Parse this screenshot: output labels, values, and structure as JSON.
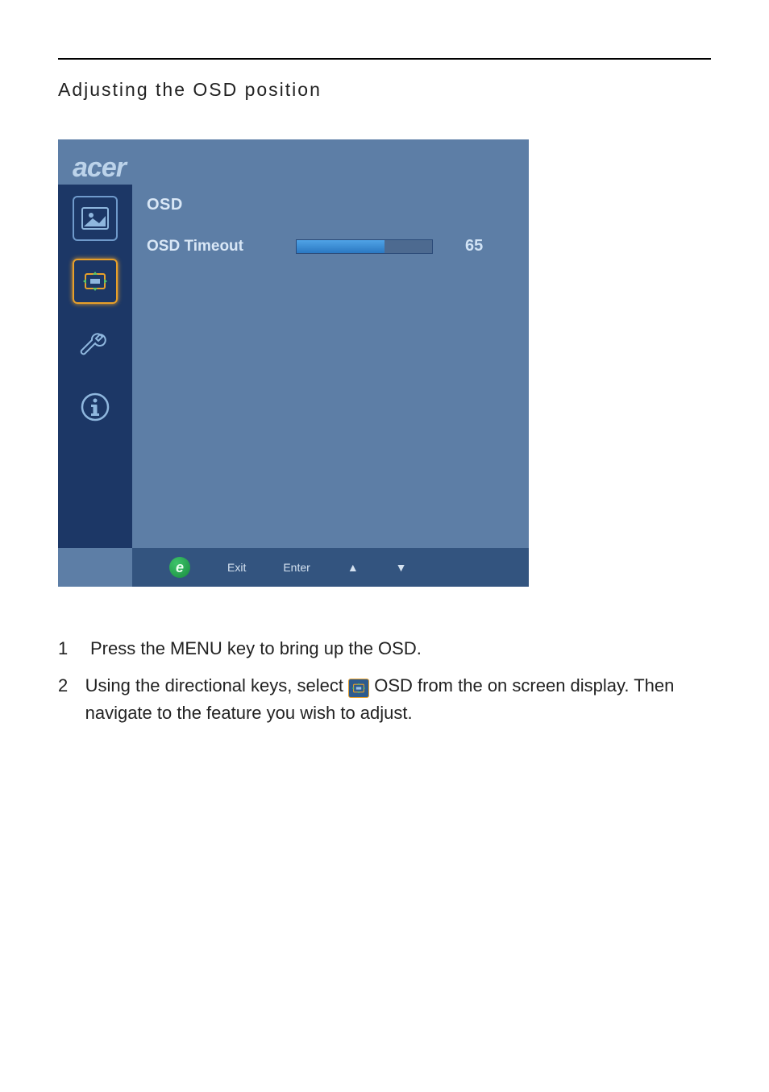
{
  "heading": "Adjusting the OSD position",
  "osd": {
    "brand": "acer",
    "menu_title": "OSD",
    "row": {
      "label": "OSD Timeout",
      "value": 65,
      "max": 100
    },
    "footer": {
      "e": "e",
      "exit": "Exit",
      "enter": "Enter"
    }
  },
  "instructions": {
    "items": [
      {
        "num": "1",
        "text": "Press the MENU key to bring up the OSD."
      },
      {
        "num": "2",
        "text_before": "Using the directional keys, select ",
        "text_after": " OSD from the on screen display. Then navigate to the feature you wish to adjust."
      }
    ]
  },
  "chart_data": {
    "type": "bar",
    "categories": [
      "OSD Timeout"
    ],
    "values": [
      65
    ],
    "title": "OSD",
    "xlabel": "",
    "ylabel": "",
    "ylim": [
      0,
      100
    ]
  }
}
